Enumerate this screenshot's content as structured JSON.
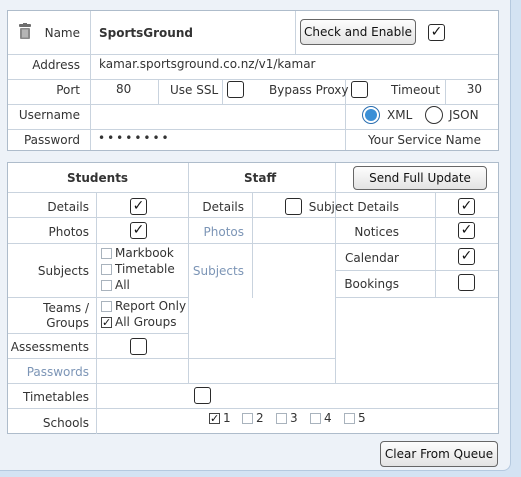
{
  "connection": {
    "name_label": "Name",
    "name_value": "SportsGround",
    "check_enable_label": "Check and Enable",
    "enabled": true,
    "address_label": "Address",
    "address_value": "kamar.sportsground.co.nz/v1/kamar",
    "port_label": "Port",
    "port_value": "80",
    "use_ssl_label": "Use SSL",
    "use_ssl": false,
    "bypass_proxy_label": "Bypass Proxy",
    "bypass_proxy": false,
    "timeout_label": "Timeout",
    "timeout_value": "30",
    "username_label": "Username",
    "username_value": "",
    "format_xml_label": "XML",
    "format_json_label": "JSON",
    "format_selected": "XML",
    "password_label": "Password",
    "password_value": "••••••••",
    "service_name_label": "Your Service Name"
  },
  "update": {
    "students_header": "Students",
    "staff_header": "Staff",
    "send_full_update_label": "Send Full Update",
    "students": {
      "details_label": "Details",
      "details": true,
      "photos_label": "Photos",
      "photos": true,
      "subjects_label": "Subjects",
      "subject_options": [
        {
          "label": "Markbook",
          "checked": false
        },
        {
          "label": "Timetable",
          "checked": false
        },
        {
          "label": "All",
          "checked": false
        }
      ],
      "teams_label_1": "Teams /",
      "teams_label_2": "Groups",
      "teams_options": [
        {
          "label": "Report Only",
          "checked": false
        },
        {
          "label": "All Groups",
          "checked": true
        }
      ],
      "assessments_label": "Assessments",
      "assessments": false,
      "passwords_label": "Passwords",
      "timetables_label": "Timetables",
      "timetables": false
    },
    "staff": {
      "details_label": "Details",
      "details": false,
      "photos_label": "Photos",
      "subjects_label": "Subjects"
    },
    "other": {
      "subject_details_label": "Subject Details",
      "subject_details": true,
      "notices_label": "Notices",
      "notices": true,
      "calendar_label": "Calendar",
      "calendar": true,
      "bookings_label": "Bookings",
      "bookings": false
    },
    "schools_label": "Schools",
    "schools": [
      {
        "label": "1",
        "checked": true
      },
      {
        "label": "2",
        "checked": false
      },
      {
        "label": "3",
        "checked": false
      },
      {
        "label": "4",
        "checked": false
      },
      {
        "label": "5",
        "checked": false
      }
    ],
    "clear_queue_label": "Clear From Queue"
  },
  "icons": {
    "trash": "trash-icon",
    "check": "check-icon"
  }
}
